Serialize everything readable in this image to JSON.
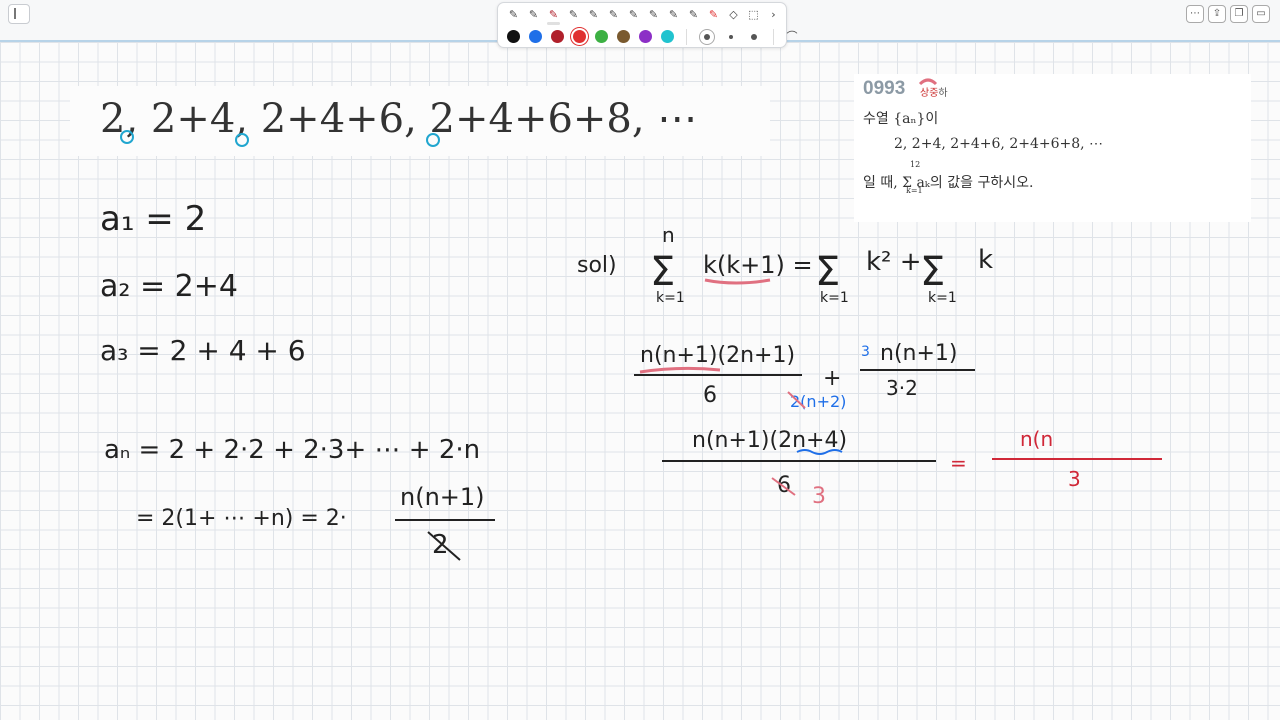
{
  "toolbar": {
    "tools": [
      "pen-1",
      "pen-2",
      "pen-3",
      "pen-4",
      "pen-5",
      "pen-6",
      "pen-7",
      "pen-8",
      "pen-9",
      "highlighter",
      "eraser",
      "lasso"
    ],
    "more": "›",
    "colors": [
      "#111111",
      "#1f6fe8",
      "#b0202b",
      "#e03030",
      "#3cb043",
      "#7a5a2f",
      "#8c2fc6",
      "#21c3cf"
    ],
    "sizes": [
      "large",
      "medium",
      "small"
    ]
  },
  "seq_banner": "2, 2+4, 2+4+6, 2+4+6+8, ⋯",
  "problem": {
    "number": "0993",
    "difficulty_high": "상",
    "difficulty_mid": "중",
    "difficulty_low": "하",
    "line1": "수열 {aₙ}이",
    "line2": "2, 2+4, 2+4+6, 2+4+6+8, ⋯",
    "line3": "일 때, Σ aₖ의 값을 구하시오.",
    "sum_top": "12",
    "sum_bottom": "k=1"
  },
  "notes": {
    "a1": "a₁ = 2",
    "a2": "a₂ = 2+4",
    "a3": "a₃ = 2 + 4 + 6",
    "an": "aₙ =  2 + 2·2  + 2·3+   ⋯   + 2·n",
    "an2": "= 2(1+ ⋯ +n) = 2·",
    "an_num": "n(n+1)",
    "an_den": "2",
    "sol": "sol)",
    "sum_expr_1": "k(k+1) =",
    "sum_expr_2": "k² +",
    "sum_expr_3": "k",
    "sum_n": "n",
    "sum_k": "k=1",
    "frac1_num": "n(n+1)(2n+1)",
    "frac1_den": "6",
    "plus": "+",
    "frac2_pre": "3",
    "frac2_num": "n(n+1)",
    "frac2_den": "3·2",
    "blue_note": "2(n+2)",
    "frac3_num": "n(n+1)(2n+4)",
    "frac3_den": "6",
    "frac3_den2": "3",
    "equals": "=",
    "result_num": "n(n",
    "result_den": "3"
  }
}
